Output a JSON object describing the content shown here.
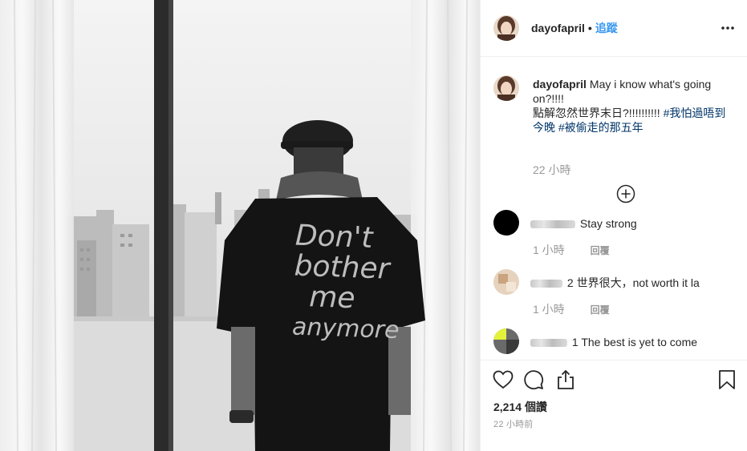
{
  "post": {
    "username": "dayofapril",
    "dot": "•",
    "follow_label": "追蹤",
    "more_icon": "more-horizontal-icon",
    "photo": {
      "description_icon": "photo",
      "shirt_text": [
        "Don't",
        "bother",
        "me",
        "anymore"
      ]
    }
  },
  "caption": {
    "username": "dayofapril",
    "text_en": "May i know what's going on?!!!!",
    "text_zh": "點解忽然世界末日?!!!!!!!!!!",
    "hashtags": [
      "#我怕過唔到今晚",
      "#被偷走的那五年"
    ],
    "time": "22 小時",
    "load_more_icon": "plus-circle-icon"
  },
  "comments": [
    {
      "text": "Stay strong",
      "time": "1 小時",
      "reply": "回覆"
    },
    {
      "text": "2 世界很大，not worth it la",
      "time": "1 小時",
      "reply": "回覆"
    },
    {
      "text": "1 The best is yet to come",
      "time": "",
      "reply": ""
    }
  ],
  "footer": {
    "icons": [
      "heart-icon",
      "comment-icon",
      "share-icon",
      "bookmark-icon"
    ],
    "views_count": "2,214",
    "views_label": "個讚",
    "posted_time": "22 小時前"
  },
  "colors": {
    "link": "#3897f0",
    "hashtag": "#003569",
    "muted": "#999999",
    "text": "#262626",
    "border": "#efefef"
  }
}
